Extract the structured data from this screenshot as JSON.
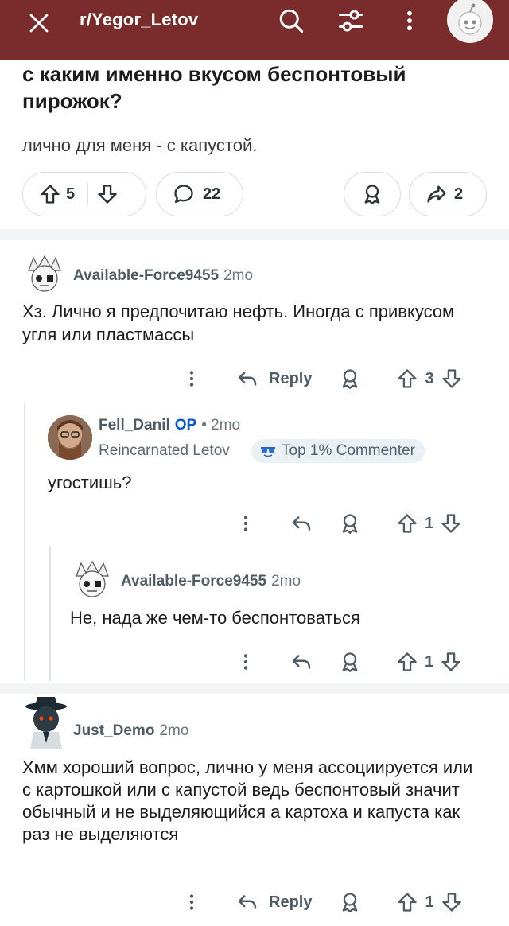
{
  "header": {
    "subreddit": "r/Yegor_Letov",
    "icons": [
      "close-icon",
      "search-icon",
      "filter-icon",
      "more-icon",
      "profile-avatar"
    ],
    "color": "#7a2c2c"
  },
  "post": {
    "title": "с каким именно вкусом беспонтовый пирожок?",
    "body": "лично для меня - с капустой.",
    "votes": "5",
    "comments": "22",
    "shares": "2"
  },
  "comments": [
    {
      "user": "Available-Force9455",
      "time": "2mo",
      "text": "Хз. Лично я предпочитаю нефть. Иногда с привкусом угля или пластмассы",
      "reply_label": "Reply",
      "votes": "3"
    },
    {
      "user": "Fell_Danil",
      "op": "OP",
      "time": "• 2mo",
      "flair": "Reincarnated Letov",
      "badge": "Top 1% Commenter",
      "text": "угостишь?",
      "votes": "1"
    },
    {
      "user": "Available-Force9455",
      "time": "2mo",
      "text": "Не, нада же чем-то беспонтоваться",
      "votes": "1"
    },
    {
      "user": "Just_Demo",
      "time": "2mo",
      "text": "Хмм хороший вопрос, лично у меня ассоциируется или с картошкой или с капустой ведь беспонтовый значит обычный и не выделяющийся а картоха и капуста как раз не выделяются",
      "reply_label": "Reply",
      "votes": "1"
    }
  ]
}
